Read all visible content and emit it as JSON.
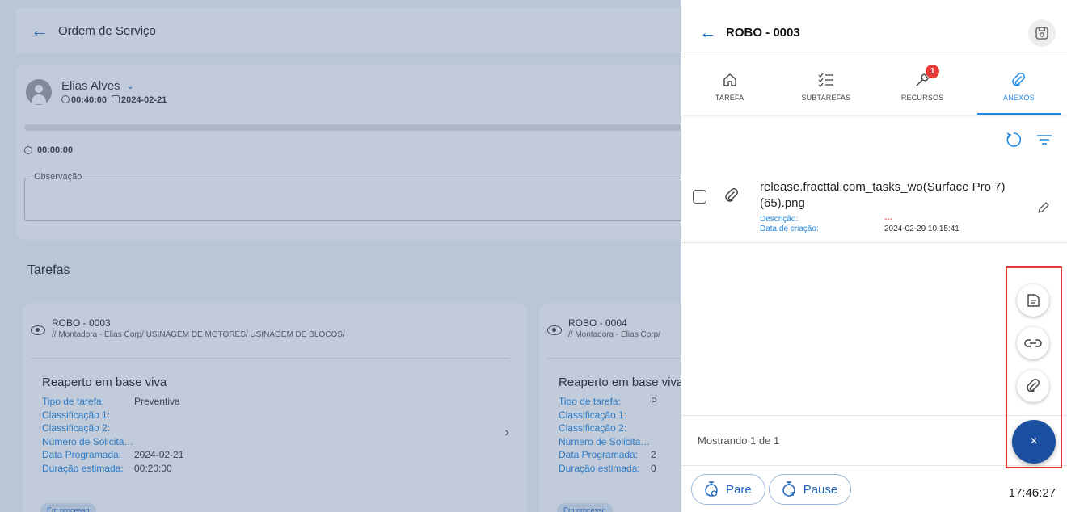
{
  "background": {
    "topbar": {
      "title": "Ordem de Serviço"
    },
    "user": {
      "name": "Elias Alves",
      "duration": "00:40:00",
      "date": "2024-02-21"
    },
    "timer": "00:00:00",
    "observation_label": "Observação",
    "tasks_title": "Tarefas",
    "cards": [
      {
        "code": "ROBO - 0003",
        "path": "// Montadora - Elias Corp/ USINAGEM DE MOTORES/ USINAGEM DE BLOCOS/",
        "title": "Reaperto em base viva",
        "fields": [
          {
            "k": "Tipo de tarefa:",
            "v": "Preventiva"
          },
          {
            "k": "Classificação 1:",
            "v": ""
          },
          {
            "k": "Classificação 2:",
            "v": ""
          },
          {
            "k": "Número de Solicitaç...",
            "v": ""
          },
          {
            "k": "Data Programada:",
            "v": "2024-02-21"
          },
          {
            "k": "Duração estimada:",
            "v": "00:20:00"
          }
        ],
        "badge": "Em processo"
      },
      {
        "code": "ROBO - 0004",
        "path": "// Montadora - Elias Corp/",
        "title": "Reaperto em base viva",
        "fields": [
          {
            "k": "Tipo de tarefa:",
            "v": "P"
          },
          {
            "k": "Classificação 1:",
            "v": ""
          },
          {
            "k": "Classificação 2:",
            "v": ""
          },
          {
            "k": "Número de Solicitaç...",
            "v": ""
          },
          {
            "k": "Data Programada:",
            "v": "2"
          },
          {
            "k": "Duração estimada:",
            "v": "0"
          }
        ],
        "badge": "Em processo"
      }
    ]
  },
  "panel": {
    "title": "ROBO - 0003",
    "tabs": [
      {
        "label": "TAREFA",
        "icon": "home-icon"
      },
      {
        "label": "SUBTAREFAS",
        "icon": "checklist-icon"
      },
      {
        "label": "RECURSOS",
        "icon": "wrench-icon",
        "badge": "1"
      },
      {
        "label": "ANEXOS",
        "icon": "paperclip-icon",
        "active": true
      }
    ],
    "attachment": {
      "name": "release.fracttal.com_tasks_wo(Surface Pro 7) (65).png",
      "description_label": "Descrição:",
      "description_value": "---",
      "created_label": "Data de criação:",
      "created_value": "2024-02-29 10:15:41"
    },
    "pagination": "Mostrando 1 de 1",
    "fab_close": "×",
    "actions": {
      "stop": "Pare",
      "pause": "Pause"
    },
    "clock": "17:46:27"
  },
  "colors": {
    "accent": "#1e88e5",
    "fab": "#1b4fa0",
    "badge": "#e53935",
    "highlight": "#e53935"
  }
}
